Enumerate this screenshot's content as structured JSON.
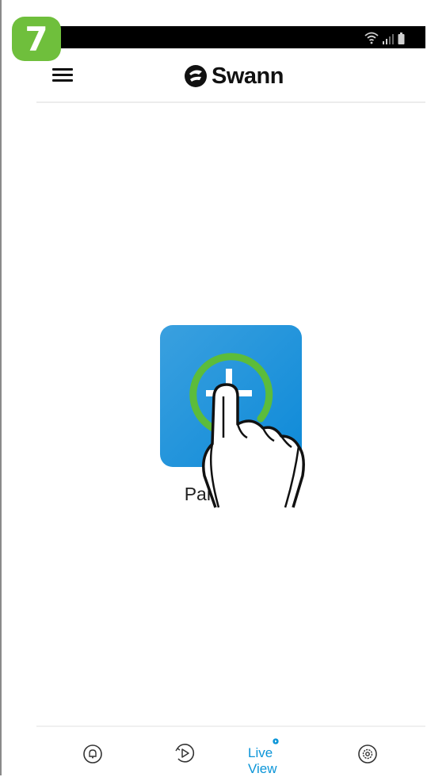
{
  "step_badge": "7",
  "header": {
    "logo_text": "Swann"
  },
  "main": {
    "pair_device_label": "Pair Device"
  },
  "bottom_nav": {
    "items": [
      {
        "icon": "bell-icon"
      },
      {
        "icon": "playback-icon"
      },
      {
        "icon": "play-icon",
        "label": "Live View",
        "active": true
      },
      {
        "icon": "gear-icon"
      }
    ]
  },
  "colors": {
    "accent": "#0b95d8",
    "badge": "#6fbf3c",
    "tile": "#1a93da",
    "ring": "#5cbc3b"
  }
}
